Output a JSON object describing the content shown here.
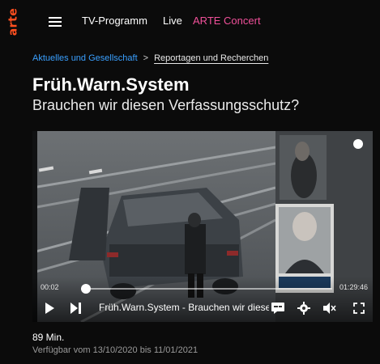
{
  "header": {
    "logo_text": "arte",
    "nav": {
      "tv_program": "TV-Programm",
      "live": "Live",
      "concert": "ARTE Concert"
    },
    "colors": {
      "logo": "#ff4f1f",
      "concert": "#f0509a"
    }
  },
  "breadcrumb": {
    "category": "Aktuelles und Gesellschaft",
    "separator": ">",
    "subcategory": "Reportagen und Recherchen"
  },
  "program": {
    "title": "Früh.Warn.System",
    "subtitle": "Brauchen wir diesen Verfassungsschutz?"
  },
  "player": {
    "time_current": "00:02",
    "time_total": "01:29:46",
    "progress": 0.02,
    "video_title": "Früh.Warn.System - Brauchen wir diesen",
    "icons": [
      "play-icon",
      "next-icon",
      "subtitles-icon",
      "gear-icon",
      "mute-icon",
      "fullscreen-icon"
    ]
  },
  "meta": {
    "duration": "89 Min.",
    "availability": "Verfügbar vom 13/10/2020 bis 11/01/2021"
  }
}
